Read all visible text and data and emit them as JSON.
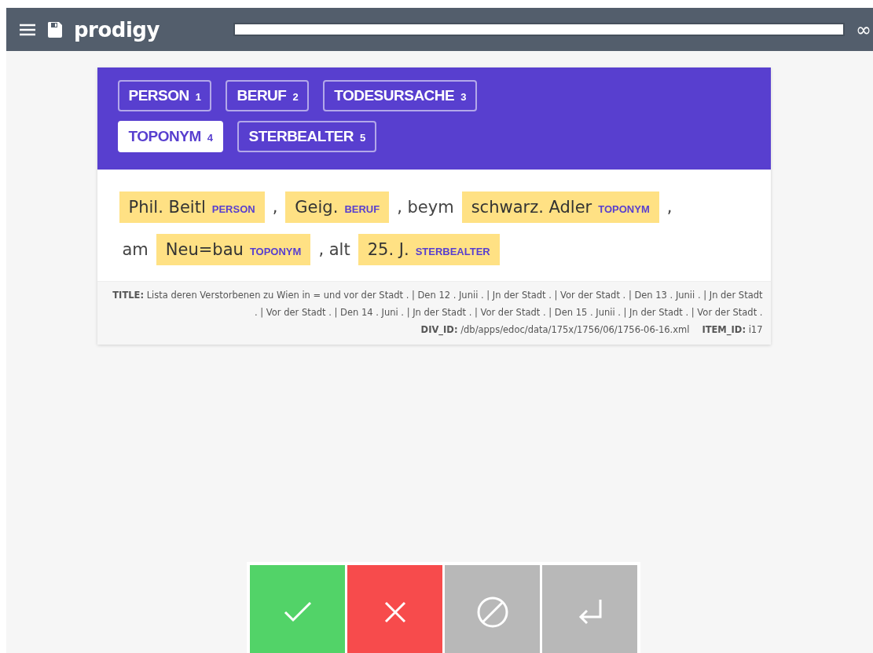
{
  "header": {
    "app_name": "prodigy",
    "progress": {
      "level": 1
    },
    "progress_text": "∞"
  },
  "labels": [
    {
      "name": "PERSON",
      "key": "1",
      "selected": false
    },
    {
      "name": "BERUF",
      "key": "2",
      "selected": false
    },
    {
      "name": "TODESURSACHE",
      "key": "3",
      "selected": false
    },
    {
      "name": "TOPONYM",
      "key": "4",
      "selected": true
    },
    {
      "name": "STERBEALTER",
      "key": "5",
      "selected": false
    }
  ],
  "text_lines": [
    [
      {
        "kind": "span",
        "text": "Phil. Beitl",
        "label": "PERSON"
      },
      {
        "kind": "plain",
        "text": ","
      },
      {
        "kind": "span",
        "text": "Geig.",
        "label": "BERUF"
      },
      {
        "kind": "plain",
        "text": ", beym"
      },
      {
        "kind": "span",
        "text": "schwarz. Adler",
        "label": "TOPONYM"
      },
      {
        "kind": "plain",
        "text": ","
      }
    ],
    [
      {
        "kind": "plain",
        "text": "am"
      },
      {
        "kind": "span",
        "text": "Neu=bau",
        "label": "TOPONYM"
      },
      {
        "kind": "plain",
        "text": ", alt"
      },
      {
        "kind": "span",
        "text": "25. J.",
        "label": "STERBEALTER"
      }
    ]
  ],
  "meta": {
    "title": "**TITLE:** Lista deren Verstorbenen zu Wien in = und vor der Stadt . | Den 12 . Junii . | Jn der Stadt . | Vor der Stadt . | Den 13 . Junii . | Jn der Stadt . | Vor der Stadt . | Den 14 . Juni . | Jn der Stadt . | Vor der Stadt . | Den 15 . Junii . | Jn der Stadt . | Vor der Stadt .",
    "ids": [
      {
        "label": "DIV_ID:",
        "value": "/db/apps/edoc/data/175x/1756/06/1756-06-16.xml"
      },
      {
        "label": "ITEM_ID:",
        "value": "i17"
      }
    ]
  },
  "actions": [
    {
      "kind": "accept"
    },
    {
      "kind": "reject"
    },
    {
      "kind": "ignore"
    },
    {
      "kind": "undo"
    }
  ]
}
